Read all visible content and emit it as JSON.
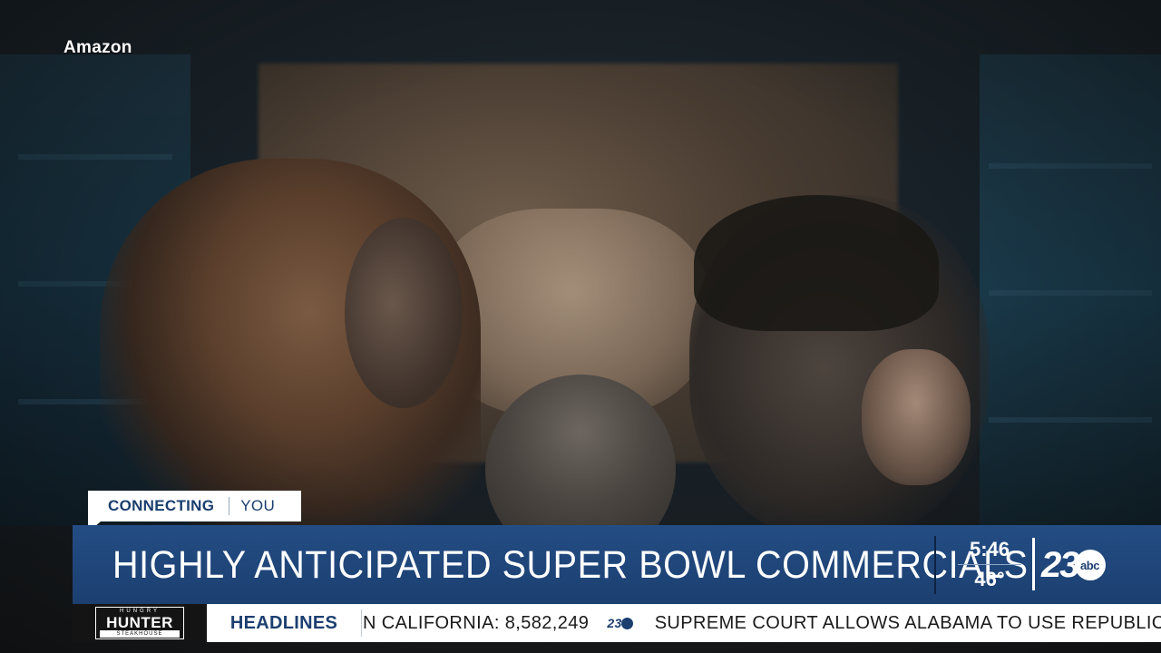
{
  "source_credit": "Amazon",
  "segment_tag": {
    "primary": "CONNECTING",
    "secondary": "YOU"
  },
  "headline": "HIGHLY ANTICIPATED SUPER BOWL COMMERCIALS",
  "status": {
    "time": "5:46",
    "temperature": "46°"
  },
  "station": {
    "number": "23",
    "network": "abc"
  },
  "ticker": {
    "sponsor_top": "HUNGRY",
    "sponsor_main": "HUNTER",
    "sponsor_bottom": "STEAKHOUSE",
    "label": "HEADLINES",
    "items": [
      "N CALIFORNIA: 8,582,249",
      "SUPREME COURT ALLOWS ALABAMA TO USE REPUBLIC"
    ],
    "separator_number": "23"
  },
  "colors": {
    "brand_blue": "#1c3f70",
    "ticker_background": "#ffffff",
    "sponsor_background": "#141414"
  }
}
